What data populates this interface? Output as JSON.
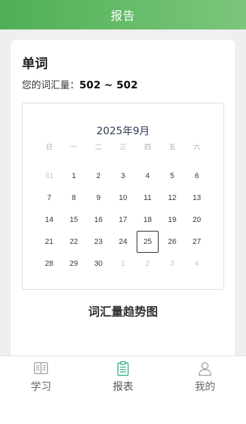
{
  "header": {
    "title": "报告"
  },
  "card": {
    "title": "单词",
    "vocab_label": "您的词汇量：",
    "vocab_value": "502 ~ 502"
  },
  "calendar": {
    "title": "2025年9月",
    "weekdays": [
      "日",
      "一",
      "二",
      "三",
      "四",
      "五",
      "六"
    ],
    "weeks": [
      [
        {
          "d": "31",
          "muted": true
        },
        {
          "d": "1"
        },
        {
          "d": "2"
        },
        {
          "d": "3"
        },
        {
          "d": "4"
        },
        {
          "d": "5"
        },
        {
          "d": "6"
        }
      ],
      [
        {
          "d": "7"
        },
        {
          "d": "8"
        },
        {
          "d": "9"
        },
        {
          "d": "10"
        },
        {
          "d": "11"
        },
        {
          "d": "12"
        },
        {
          "d": "13"
        }
      ],
      [
        {
          "d": "14"
        },
        {
          "d": "15"
        },
        {
          "d": "16"
        },
        {
          "d": "17"
        },
        {
          "d": "18"
        },
        {
          "d": "19"
        },
        {
          "d": "20"
        }
      ],
      [
        {
          "d": "21"
        },
        {
          "d": "22"
        },
        {
          "d": "23"
        },
        {
          "d": "24"
        },
        {
          "d": "25",
          "selected": true
        },
        {
          "d": "26"
        },
        {
          "d": "27"
        }
      ],
      [
        {
          "d": "28"
        },
        {
          "d": "29"
        },
        {
          "d": "30"
        },
        {
          "d": "1",
          "muted": true
        },
        {
          "d": "2",
          "muted": true
        },
        {
          "d": "3",
          "muted": true
        },
        {
          "d": "4",
          "muted": true
        }
      ]
    ]
  },
  "trend": {
    "title": "词汇量趋势图"
  },
  "tabs": [
    {
      "label": "学习",
      "icon": "book-icon",
      "active": false
    },
    {
      "label": "报表",
      "icon": "clipboard-icon",
      "active": true
    },
    {
      "label": "我的",
      "icon": "user-icon",
      "active": false
    }
  ],
  "colors": {
    "header_start": "#4fb054",
    "header_end": "#7bc67c",
    "active_tab": "#3bb08f",
    "inactive_tab": "#999999"
  }
}
